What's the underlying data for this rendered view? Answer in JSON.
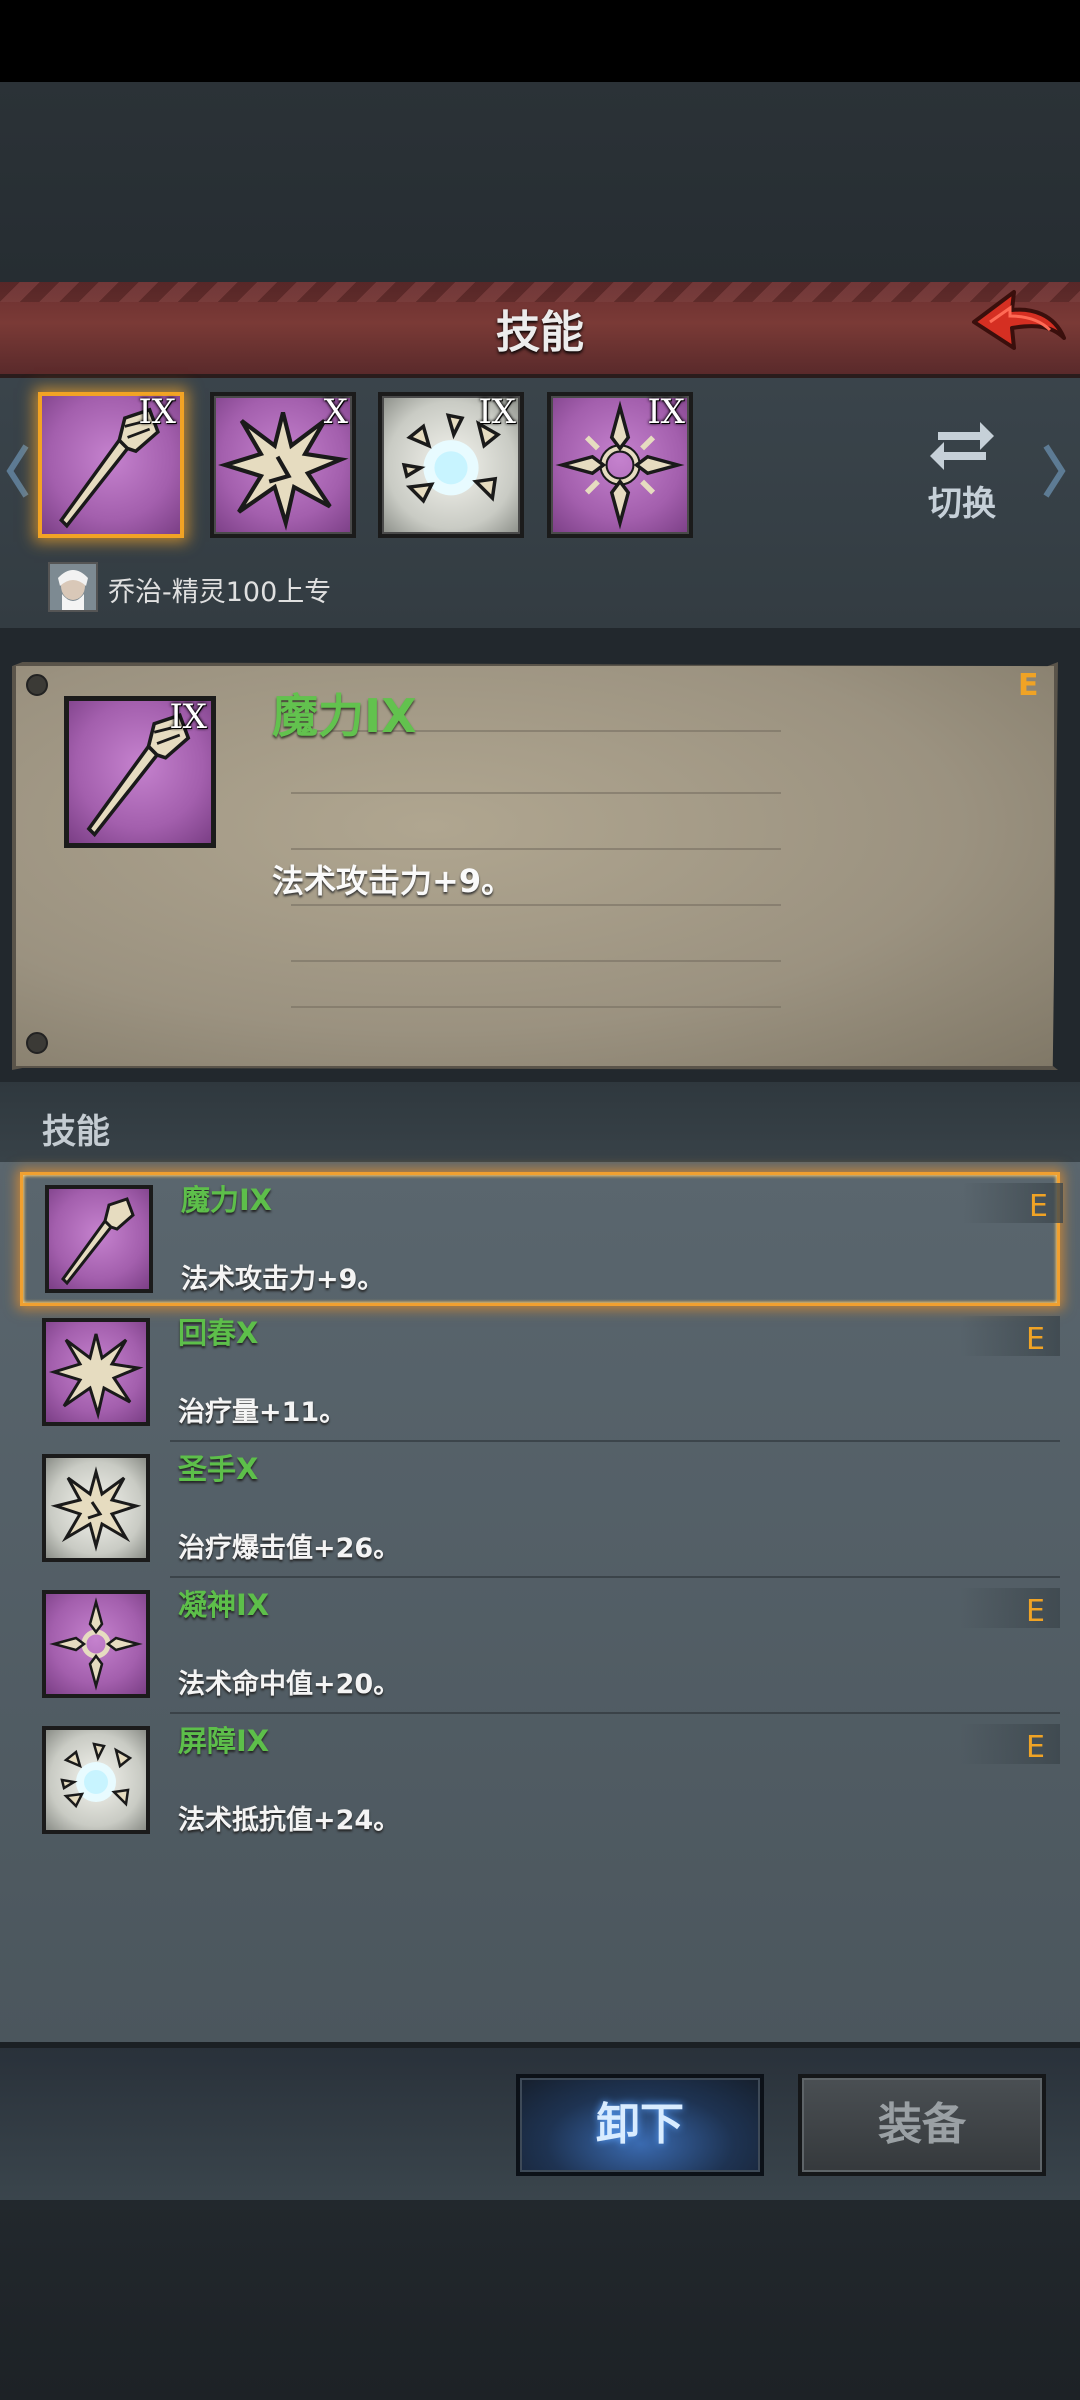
{
  "header": {
    "title": "技能"
  },
  "top_skills": [
    {
      "numeral": "IX",
      "icon": "staff-icon",
      "style": "purple",
      "selected": true
    },
    {
      "numeral": "X",
      "icon": "burst-icon",
      "style": "purple",
      "selected": false
    },
    {
      "numeral": "IX",
      "icon": "shatter-icon",
      "style": "white",
      "selected": false
    },
    {
      "numeral": "IX",
      "icon": "crosshair-icon",
      "style": "purple",
      "selected": false
    }
  ],
  "switch": {
    "label": "切换"
  },
  "owner": {
    "name": "乔治-精灵100上专"
  },
  "detail": {
    "numeral": "IX",
    "name": "魔力IX",
    "description": "法术攻击力+9。",
    "badge": "E"
  },
  "list": {
    "header": "技能",
    "items": [
      {
        "name": "魔力IX",
        "description": "法术攻击力+9。",
        "badge": "E",
        "icon": "staff-icon",
        "selected": true
      },
      {
        "name": "回春X",
        "description": "治疗量+11。",
        "badge": "E",
        "icon": "burst-icon",
        "selected": false
      },
      {
        "name": "圣手X",
        "description": "治疗爆击值+26。",
        "badge": "",
        "icon": "shatter-burst-icon",
        "selected": false
      },
      {
        "name": "凝神IX",
        "description": "法术命中值+20。",
        "badge": "E",
        "icon": "crosshair-icon",
        "selected": false
      },
      {
        "name": "屏障IX",
        "description": "法术抵抗值+24。",
        "badge": "E",
        "icon": "shatter-icon",
        "selected": false
      }
    ]
  },
  "buttons": {
    "unequip": "卸下",
    "equip": "装备"
  },
  "colors": {
    "skill_name": "#5dbf4a",
    "badge": "#f0a325",
    "selection": "#f0a030"
  }
}
